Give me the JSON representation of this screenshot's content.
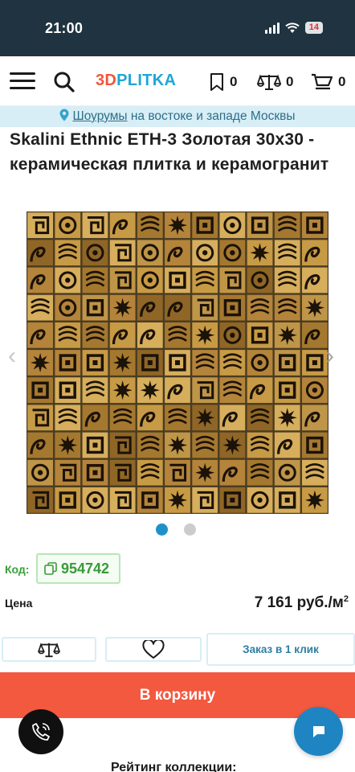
{
  "status_bar": {
    "time": "21:00",
    "battery": "14"
  },
  "header": {
    "logo_part1": "3D",
    "logo_part2": "PLITKA",
    "favorites_count": "0",
    "compare_count": "0",
    "cart_count": "0"
  },
  "banner": {
    "link": "Шоурумы",
    "text": " на востоке и западе Москвы"
  },
  "product": {
    "title": "Skalini Ethnic ETH-3 Золотая 30x30 - керамическая плитка и керамогранит",
    "code_label": "Код:",
    "code": "954742",
    "price_label": "Цена",
    "price": "7 161 руб./м",
    "price_unit_sup": "2"
  },
  "gallery": {
    "arrow_left": "‹",
    "arrow_right": "›",
    "active_index": 0,
    "count": 2
  },
  "actions": {
    "quick_order": "Заказ в 1 клик",
    "add_to_cart": "В корзину"
  },
  "footer": {
    "rating_heading": "Рейтинг коллекции:"
  },
  "colors": {
    "accent_orange": "#f2593f",
    "accent_blue": "#1fa6d6",
    "code_green": "#3a9a3a",
    "banner_bg": "#d8eef6",
    "dot_active": "#1f91c9",
    "dot_inactive": "#cccccc"
  },
  "icons": [
    "menu-icon",
    "search-icon",
    "bookmark-icon",
    "scales-icon",
    "cart-icon",
    "location-pin-icon",
    "copy-icon",
    "heart-icon",
    "phone-icon",
    "chat-icon"
  ]
}
